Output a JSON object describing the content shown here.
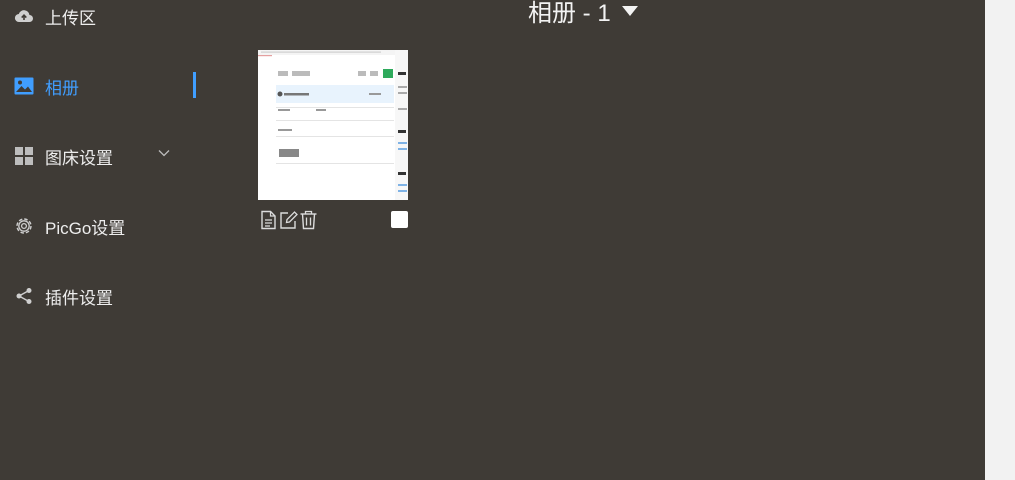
{
  "sidebar": {
    "items": [
      {
        "label": "上传区",
        "icon": "cloud-upload-icon"
      },
      {
        "label": "相册",
        "icon": "image-icon",
        "active": true
      },
      {
        "label": "图床设置",
        "icon": "grid-icon",
        "expandable": true
      },
      {
        "label": "PicGo设置",
        "icon": "gear-icon"
      },
      {
        "label": "插件设置",
        "icon": "share-icon"
      }
    ]
  },
  "gallery": {
    "title": "相册 - 1"
  },
  "image_card": {
    "thumbnail_icon": "screenshot-thumbnail",
    "actions": [
      "copy-link-icon",
      "edit-icon",
      "delete-icon"
    ],
    "selected": false
  },
  "colors": {
    "background": "#3f3b36",
    "accent": "#409eff",
    "text": "#eeeeee"
  }
}
